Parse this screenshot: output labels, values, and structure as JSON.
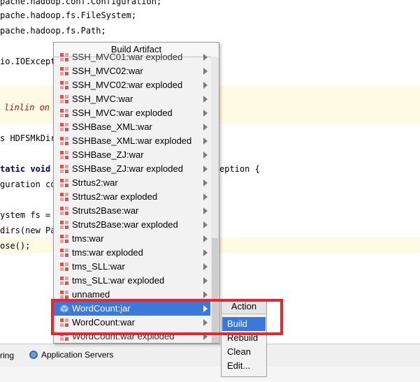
{
  "editor": {
    "lines": [
      {
        "text": "pache.hadoop.conf.Configuration;"
      },
      {
        "text": "pache.hadoop.fs.FileSystem;"
      },
      {
        "text": "pache.hadoop.fs.Path;"
      },
      {
        "text": "io.IOExcept"
      },
      {
        "text": "linlin on"
      },
      {
        "text": "s HDFSMkDir"
      },
      {
        "text": "tatic void",
        "tail": "eption {"
      },
      {
        "text": "guration co"
      },
      {
        "text": "ystem fs ="
      },
      {
        "text": "dirs(new Pa"
      },
      {
        "text": "ose();"
      }
    ]
  },
  "popup": {
    "title": "Build Artifact",
    "items": [
      {
        "label": "SSH_MVC01:war exploded",
        "partial": true
      },
      {
        "label": "SSH_MVC02:war"
      },
      {
        "label": "SSH_MVC02:war exploded"
      },
      {
        "label": "SSH_MVC:war"
      },
      {
        "label": "SSH_MVC:war exploded"
      },
      {
        "label": "SSHBase_XML:war"
      },
      {
        "label": "SSHBase_XML:war exploded"
      },
      {
        "label": "SSHBase_ZJ:war"
      },
      {
        "label": "SSHBase_ZJ:war exploded"
      },
      {
        "label": "Strtus2:war"
      },
      {
        "label": "Strtus2:war exploded"
      },
      {
        "label": "Struts2Base:war"
      },
      {
        "label": "Struts2Base:war exploded"
      },
      {
        "label": "tms:war"
      },
      {
        "label": "tms:war exploded"
      },
      {
        "label": "tms_SLL:war"
      },
      {
        "label": "tms_SLL:war exploded"
      },
      {
        "label": "unnamed"
      },
      {
        "label": "WordCount:jar",
        "selected": true,
        "icon": "jar"
      },
      {
        "label": "WordCount:war"
      },
      {
        "label": "WordCount:war exploded",
        "partial": true
      }
    ]
  },
  "submenu": {
    "header": "Action",
    "options": [
      {
        "label": "Build",
        "selected": true
      },
      {
        "label": "Rebuild"
      },
      {
        "label": "Clean"
      },
      {
        "label": "Edit..."
      }
    ]
  },
  "bottom_bar": {
    "left_text": "ring",
    "app_servers": "Application Servers"
  },
  "colors": {
    "selection": "#3b78d8",
    "highlight_box": "#e8262b",
    "comment": "#e00000",
    "keyword": "#000080"
  }
}
